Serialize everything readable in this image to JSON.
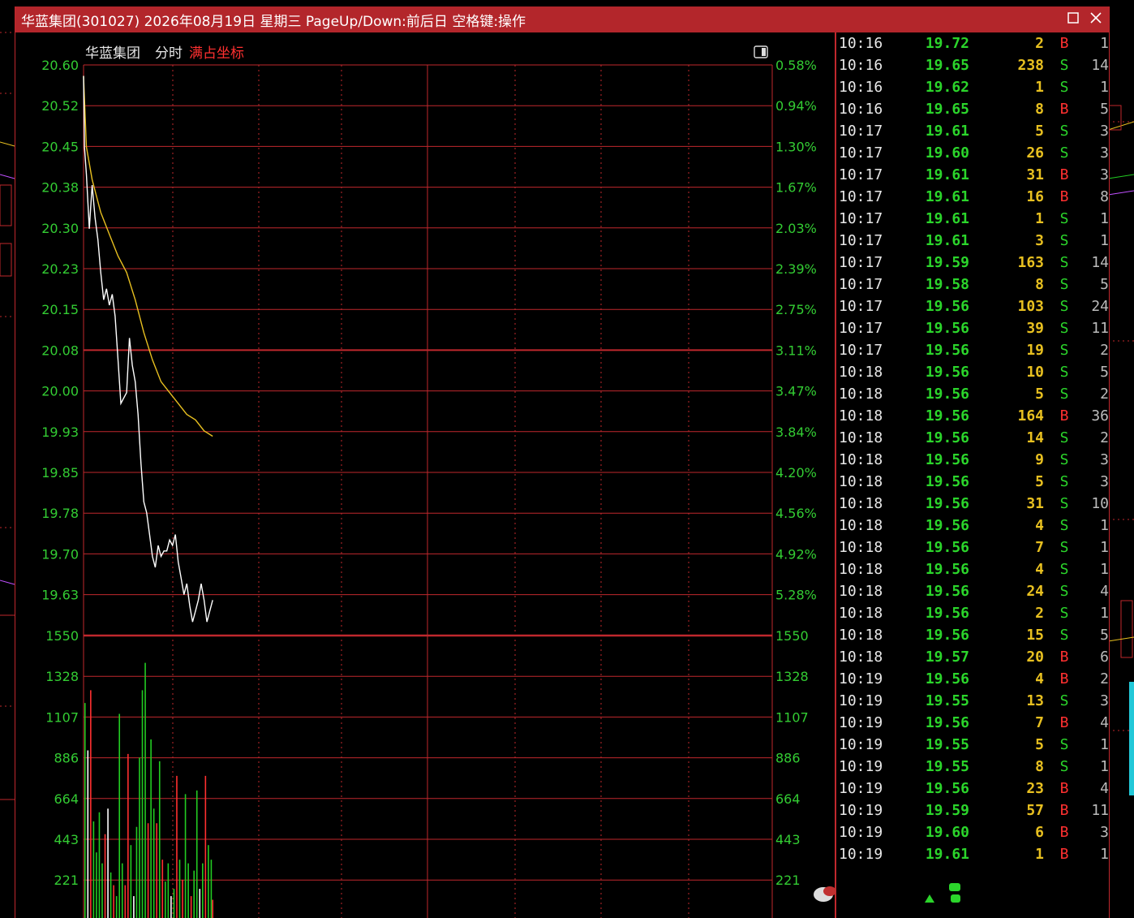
{
  "window": {
    "title": "华蓝集团(301027) 2026年08月19日 星期三 PageUp/Down:前后日 空格键:操作",
    "maximize_icon": "square-icon",
    "close_icon": "x-icon"
  },
  "chart_header": {
    "stock_name": "华蓝集团",
    "mode": "分时",
    "scale_mode": "满占坐标",
    "scale_mode_color": "#ff3030"
  },
  "colors": {
    "grid": "#c0282d",
    "price_line": "#ffffff",
    "avg_line": "#e8c020",
    "axis_label": "#33cc33",
    "volume_up": "#ff3030",
    "volume_down": "#22cc22",
    "volume_neutral": "#ffffff"
  },
  "chart_data": {
    "type": "line",
    "price_axis_left": [
      "20.60",
      "20.52",
      "20.45",
      "20.38",
      "20.30",
      "20.23",
      "20.15",
      "20.08",
      "20.00",
      "19.93",
      "19.85",
      "19.78",
      "19.70",
      "19.63"
    ],
    "price_axis_right": [
      "0.58%",
      "0.94%",
      "1.30%",
      "1.67%",
      "2.03%",
      "2.39%",
      "2.75%",
      "3.11%",
      "3.47%",
      "3.84%",
      "4.20%",
      "4.56%",
      "4.92%",
      "5.28%"
    ],
    "volume_axis": [
      "1550",
      "1328",
      "1107",
      "886",
      "664",
      "443",
      "221"
    ],
    "ylim_price": [
      19.63,
      20.6
    ],
    "ylim_volume": [
      0,
      1550
    ],
    "minutes_total": 240,
    "price_series": [
      {
        "t": 0,
        "p": 20.58
      },
      {
        "t": 0.3,
        "p": 20.45
      },
      {
        "t": 1,
        "p": 20.4
      },
      {
        "t": 2,
        "p": 20.3
      },
      {
        "t": 3,
        "p": 20.38
      },
      {
        "t": 4,
        "p": 20.32
      },
      {
        "t": 5,
        "p": 20.28
      },
      {
        "t": 6,
        "p": 20.22
      },
      {
        "t": 7,
        "p": 20.17
      },
      {
        "t": 8,
        "p": 20.19
      },
      {
        "t": 9,
        "p": 20.16
      },
      {
        "t": 10,
        "p": 20.18
      },
      {
        "t": 11,
        "p": 20.14
      },
      {
        "t": 12,
        "p": 20.06
      },
      {
        "t": 13,
        "p": 19.98
      },
      {
        "t": 14,
        "p": 19.99
      },
      {
        "t": 15,
        "p": 20.0
      },
      {
        "t": 16,
        "p": 20.1
      },
      {
        "t": 17,
        "p": 20.05
      },
      {
        "t": 18,
        "p": 20.02
      },
      {
        "t": 19,
        "p": 19.96
      },
      {
        "t": 20,
        "p": 19.87
      },
      {
        "t": 21,
        "p": 19.8
      },
      {
        "t": 22,
        "p": 19.78
      },
      {
        "t": 23,
        "p": 19.74
      },
      {
        "t": 24,
        "p": 19.7
      },
      {
        "t": 25,
        "p": 19.68
      },
      {
        "t": 26,
        "p": 19.72
      },
      {
        "t": 27,
        "p": 19.7
      },
      {
        "t": 28,
        "p": 19.71
      },
      {
        "t": 29,
        "p": 19.71
      },
      {
        "t": 30,
        "p": 19.73
      },
      {
        "t": 31,
        "p": 19.72
      },
      {
        "t": 32,
        "p": 19.74
      },
      {
        "t": 33,
        "p": 19.69
      },
      {
        "t": 34,
        "p": 19.66
      },
      {
        "t": 35,
        "p": 19.63
      },
      {
        "t": 36,
        "p": 19.65
      },
      {
        "t": 37,
        "p": 19.61
      },
      {
        "t": 38,
        "p": 19.58
      },
      {
        "t": 39,
        "p": 19.6
      },
      {
        "t": 40,
        "p": 19.62
      },
      {
        "t": 41,
        "p": 19.65
      },
      {
        "t": 42,
        "p": 19.62
      },
      {
        "t": 43,
        "p": 19.58
      },
      {
        "t": 44,
        "p": 19.6
      },
      {
        "t": 45,
        "p": 19.62
      }
    ],
    "avg_series": [
      {
        "t": 0,
        "p": 20.58
      },
      {
        "t": 1,
        "p": 20.45
      },
      {
        "t": 3,
        "p": 20.39
      },
      {
        "t": 6,
        "p": 20.33
      },
      {
        "t": 9,
        "p": 20.29
      },
      {
        "t": 12,
        "p": 20.25
      },
      {
        "t": 15,
        "p": 20.22
      },
      {
        "t": 18,
        "p": 20.17
      },
      {
        "t": 21,
        "p": 20.11
      },
      {
        "t": 24,
        "p": 20.06
      },
      {
        "t": 27,
        "p": 20.02
      },
      {
        "t": 30,
        "p": 20.0
      },
      {
        "t": 33,
        "p": 19.98
      },
      {
        "t": 36,
        "p": 19.96
      },
      {
        "t": 39,
        "p": 19.95
      },
      {
        "t": 42,
        "p": 19.93
      },
      {
        "t": 45,
        "p": 19.92
      }
    ],
    "volume_series": [
      {
        "t": 0.5,
        "v": 1180,
        "d": "down"
      },
      {
        "t": 1.5,
        "v": 920,
        "d": "neutral"
      },
      {
        "t": 2.5,
        "v": 1250,
        "d": "up"
      },
      {
        "t": 3.5,
        "v": 530,
        "d": "down"
      },
      {
        "t": 4.5,
        "v": 360,
        "d": "down"
      },
      {
        "t": 5.5,
        "v": 580,
        "d": "down"
      },
      {
        "t": 6.5,
        "v": 300,
        "d": "down"
      },
      {
        "t": 7.5,
        "v": 460,
        "d": "up"
      },
      {
        "t": 8.5,
        "v": 600,
        "d": "neutral"
      },
      {
        "t": 9.5,
        "v": 250,
        "d": "down"
      },
      {
        "t": 10.5,
        "v": 180,
        "d": "up"
      },
      {
        "t": 11.5,
        "v": 120,
        "d": "down"
      },
      {
        "t": 12.5,
        "v": 1120,
        "d": "down"
      },
      {
        "t": 13.5,
        "v": 300,
        "d": "down"
      },
      {
        "t": 14.5,
        "v": 180,
        "d": "up"
      },
      {
        "t": 15.5,
        "v": 900,
        "d": "up"
      },
      {
        "t": 16.5,
        "v": 400,
        "d": "down"
      },
      {
        "t": 17.5,
        "v": 120,
        "d": "neutral"
      },
      {
        "t": 18.5,
        "v": 500,
        "d": "down"
      },
      {
        "t": 19.5,
        "v": 880,
        "d": "down"
      },
      {
        "t": 20.5,
        "v": 1250,
        "d": "down"
      },
      {
        "t": 21.5,
        "v": 1400,
        "d": "down"
      },
      {
        "t": 22.5,
        "v": 520,
        "d": "up"
      },
      {
        "t": 23.5,
        "v": 980,
        "d": "down"
      },
      {
        "t": 24.5,
        "v": 600,
        "d": "down"
      },
      {
        "t": 25.5,
        "v": 520,
        "d": "up"
      },
      {
        "t": 26.5,
        "v": 860,
        "d": "down"
      },
      {
        "t": 27.5,
        "v": 320,
        "d": "up"
      },
      {
        "t": 28.5,
        "v": 200,
        "d": "down"
      },
      {
        "t": 29.5,
        "v": 300,
        "d": "down"
      },
      {
        "t": 30.5,
        "v": 120,
        "d": "neutral"
      },
      {
        "t": 31.5,
        "v": 160,
        "d": "down"
      },
      {
        "t": 32.5,
        "v": 780,
        "d": "up"
      },
      {
        "t": 33.5,
        "v": 320,
        "d": "down"
      },
      {
        "t": 34.5,
        "v": 210,
        "d": "up"
      },
      {
        "t": 35.5,
        "v": 680,
        "d": "down"
      },
      {
        "t": 36.5,
        "v": 300,
        "d": "down"
      },
      {
        "t": 37.5,
        "v": 120,
        "d": "up"
      },
      {
        "t": 38.5,
        "v": 260,
        "d": "down"
      },
      {
        "t": 39.5,
        "v": 700,
        "d": "down"
      },
      {
        "t": 40.5,
        "v": 160,
        "d": "neutral"
      },
      {
        "t": 41.5,
        "v": 300,
        "d": "down"
      },
      {
        "t": 42.5,
        "v": 780,
        "d": "up"
      },
      {
        "t": 43.5,
        "v": 400,
        "d": "down"
      },
      {
        "t": 44.5,
        "v": 320,
        "d": "down"
      },
      {
        "t": 45,
        "v": 100,
        "d": "up"
      }
    ]
  },
  "ticks": [
    {
      "time": "10:16",
      "price": "19.72",
      "vol": "2",
      "bs": "B",
      "n": "1"
    },
    {
      "time": "10:16",
      "price": "19.65",
      "vol": "238",
      "bs": "S",
      "n": "14"
    },
    {
      "time": "10:16",
      "price": "19.62",
      "vol": "1",
      "bs": "S",
      "n": "1"
    },
    {
      "time": "10:16",
      "price": "19.65",
      "vol": "8",
      "bs": "B",
      "n": "5"
    },
    {
      "time": "10:17",
      "price": "19.61",
      "vol": "5",
      "bs": "S",
      "n": "3"
    },
    {
      "time": "10:17",
      "price": "19.60",
      "vol": "26",
      "bs": "S",
      "n": "3"
    },
    {
      "time": "10:17",
      "price": "19.61",
      "vol": "31",
      "bs": "B",
      "n": "3"
    },
    {
      "time": "10:17",
      "price": "19.61",
      "vol": "16",
      "bs": "B",
      "n": "8"
    },
    {
      "time": "10:17",
      "price": "19.61",
      "vol": "1",
      "bs": "S",
      "n": "1"
    },
    {
      "time": "10:17",
      "price": "19.61",
      "vol": "3",
      "bs": "S",
      "n": "1"
    },
    {
      "time": "10:17",
      "price": "19.59",
      "vol": "163",
      "bs": "S",
      "n": "14"
    },
    {
      "time": "10:17",
      "price": "19.58",
      "vol": "8",
      "bs": "S",
      "n": "5"
    },
    {
      "time": "10:17",
      "price": "19.56",
      "vol": "103",
      "bs": "S",
      "n": "24"
    },
    {
      "time": "10:17",
      "price": "19.56",
      "vol": "39",
      "bs": "S",
      "n": "11"
    },
    {
      "time": "10:17",
      "price": "19.56",
      "vol": "19",
      "bs": "S",
      "n": "2"
    },
    {
      "time": "10:18",
      "price": "19.56",
      "vol": "10",
      "bs": "S",
      "n": "5"
    },
    {
      "time": "10:18",
      "price": "19.56",
      "vol": "5",
      "bs": "S",
      "n": "2"
    },
    {
      "time": "10:18",
      "price": "19.56",
      "vol": "164",
      "bs": "B",
      "n": "36"
    },
    {
      "time": "10:18",
      "price": "19.56",
      "vol": "14",
      "bs": "S",
      "n": "2"
    },
    {
      "time": "10:18",
      "price": "19.56",
      "vol": "9",
      "bs": "S",
      "n": "3"
    },
    {
      "time": "10:18",
      "price": "19.56",
      "vol": "5",
      "bs": "S",
      "n": "3"
    },
    {
      "time": "10:18",
      "price": "19.56",
      "vol": "31",
      "bs": "S",
      "n": "10"
    },
    {
      "time": "10:18",
      "price": "19.56",
      "vol": "4",
      "bs": "S",
      "n": "1"
    },
    {
      "time": "10:18",
      "price": "19.56",
      "vol": "7",
      "bs": "S",
      "n": "1"
    },
    {
      "time": "10:18",
      "price": "19.56",
      "vol": "4",
      "bs": "S",
      "n": "1"
    },
    {
      "time": "10:18",
      "price": "19.56",
      "vol": "24",
      "bs": "S",
      "n": "4"
    },
    {
      "time": "10:18",
      "price": "19.56",
      "vol": "2",
      "bs": "S",
      "n": "1"
    },
    {
      "time": "10:18",
      "price": "19.56",
      "vol": "15",
      "bs": "S",
      "n": "5"
    },
    {
      "time": "10:18",
      "price": "19.57",
      "vol": "20",
      "bs": "B",
      "n": "6"
    },
    {
      "time": "10:19",
      "price": "19.56",
      "vol": "4",
      "bs": "B",
      "n": "2"
    },
    {
      "time": "10:19",
      "price": "19.55",
      "vol": "13",
      "bs": "S",
      "n": "3"
    },
    {
      "time": "10:19",
      "price": "19.56",
      "vol": "7",
      "bs": "B",
      "n": "4"
    },
    {
      "time": "10:19",
      "price": "19.55",
      "vol": "5",
      "bs": "S",
      "n": "1"
    },
    {
      "time": "10:19",
      "price": "19.55",
      "vol": "8",
      "bs": "S",
      "n": "1"
    },
    {
      "time": "10:19",
      "price": "19.56",
      "vol": "23",
      "bs": "B",
      "n": "4"
    },
    {
      "time": "10:19",
      "price": "19.59",
      "vol": "57",
      "bs": "B",
      "n": "11"
    },
    {
      "time": "10:19",
      "price": "19.60",
      "vol": "6",
      "bs": "B",
      "n": "3"
    },
    {
      "time": "10:19",
      "price": "19.61",
      "vol": "1",
      "bs": "B",
      "n": "1"
    }
  ]
}
